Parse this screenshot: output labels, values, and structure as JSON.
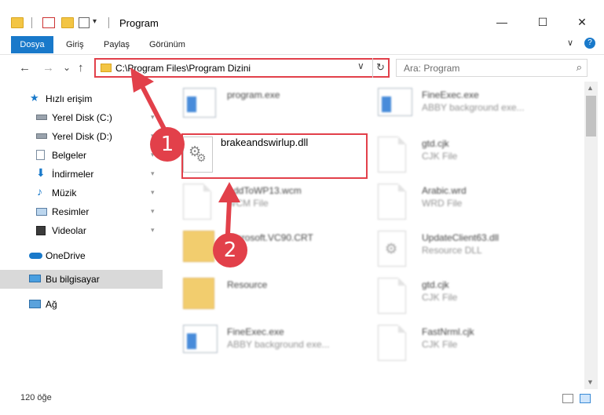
{
  "window": {
    "title": "Program",
    "minimize_glyph": "—",
    "maximize_glyph": "☐",
    "close_glyph": "✕"
  },
  "ribbon": {
    "tabs": [
      "Dosya",
      "Giriş",
      "Paylaş",
      "Görünüm"
    ],
    "collapse_glyph": "∨",
    "help_glyph": "?"
  },
  "nav_buttons": {
    "back": "←",
    "forward": "→",
    "recent": "⌄",
    "up": "↑"
  },
  "address": {
    "path": "C:\\Program Files\\Program Dizini",
    "dropdown_glyph": "∨",
    "refresh_glyph": "↻"
  },
  "search": {
    "placeholder": "Ara: Program",
    "icon_glyph": "⌕"
  },
  "nav_pane": {
    "items": [
      {
        "label": "Hızlı erişim",
        "icon": "star-icon"
      },
      {
        "label": "Yerel Disk (C:)",
        "icon": "drive-icon"
      },
      {
        "label": "Yerel Disk (D:)",
        "icon": "drive-icon"
      },
      {
        "label": "Belgeler",
        "icon": "documents-icon"
      },
      {
        "label": "İndirmeler",
        "icon": "download-icon"
      },
      {
        "label": "Müzik",
        "icon": "music-icon"
      },
      {
        "label": "Resimler",
        "icon": "pictures-icon"
      },
      {
        "label": "Videolar",
        "icon": "videos-icon"
      },
      {
        "label": "OneDrive",
        "icon": "cloud-icon"
      },
      {
        "label": "Bu bilgisayar",
        "icon": "computer-icon"
      },
      {
        "label": "Ağ",
        "icon": "network-icon"
      }
    ],
    "pin_glyph": "📌"
  },
  "files": {
    "left": [
      {
        "name": "program.exe",
        "type": ""
      },
      {
        "name": "brakeandswirlup.dll",
        "type": ""
      },
      {
        "name": "AddToWP13.wcm",
        "type": "WCM File"
      },
      {
        "name": "Microsoft.VC90.CRT",
        "type": ""
      },
      {
        "name": "Resource",
        "type": ""
      },
      {
        "name": "FineExec.exe",
        "type": "ABBY background exe..."
      }
    ],
    "right": [
      {
        "name": "FineExec.exe",
        "type": "ABBY background exe..."
      },
      {
        "name": "gtd.cjk",
        "type": "CJK File"
      },
      {
        "name": "Arabic.wrd",
        "type": "WRD File"
      },
      {
        "name": "UpdateClient63.dll",
        "type": "Resource DLL"
      },
      {
        "name": "gtd.cjk",
        "type": "CJK File"
      },
      {
        "name": "FastNrml.cjk",
        "type": "CJK File"
      }
    ]
  },
  "status": {
    "item_count": "120 öğe"
  },
  "annotations": {
    "step1": "1",
    "step2": "2"
  },
  "colors": {
    "accent": "#1979ca",
    "annotation": "#e2404a",
    "selected": "#cce8ff"
  }
}
